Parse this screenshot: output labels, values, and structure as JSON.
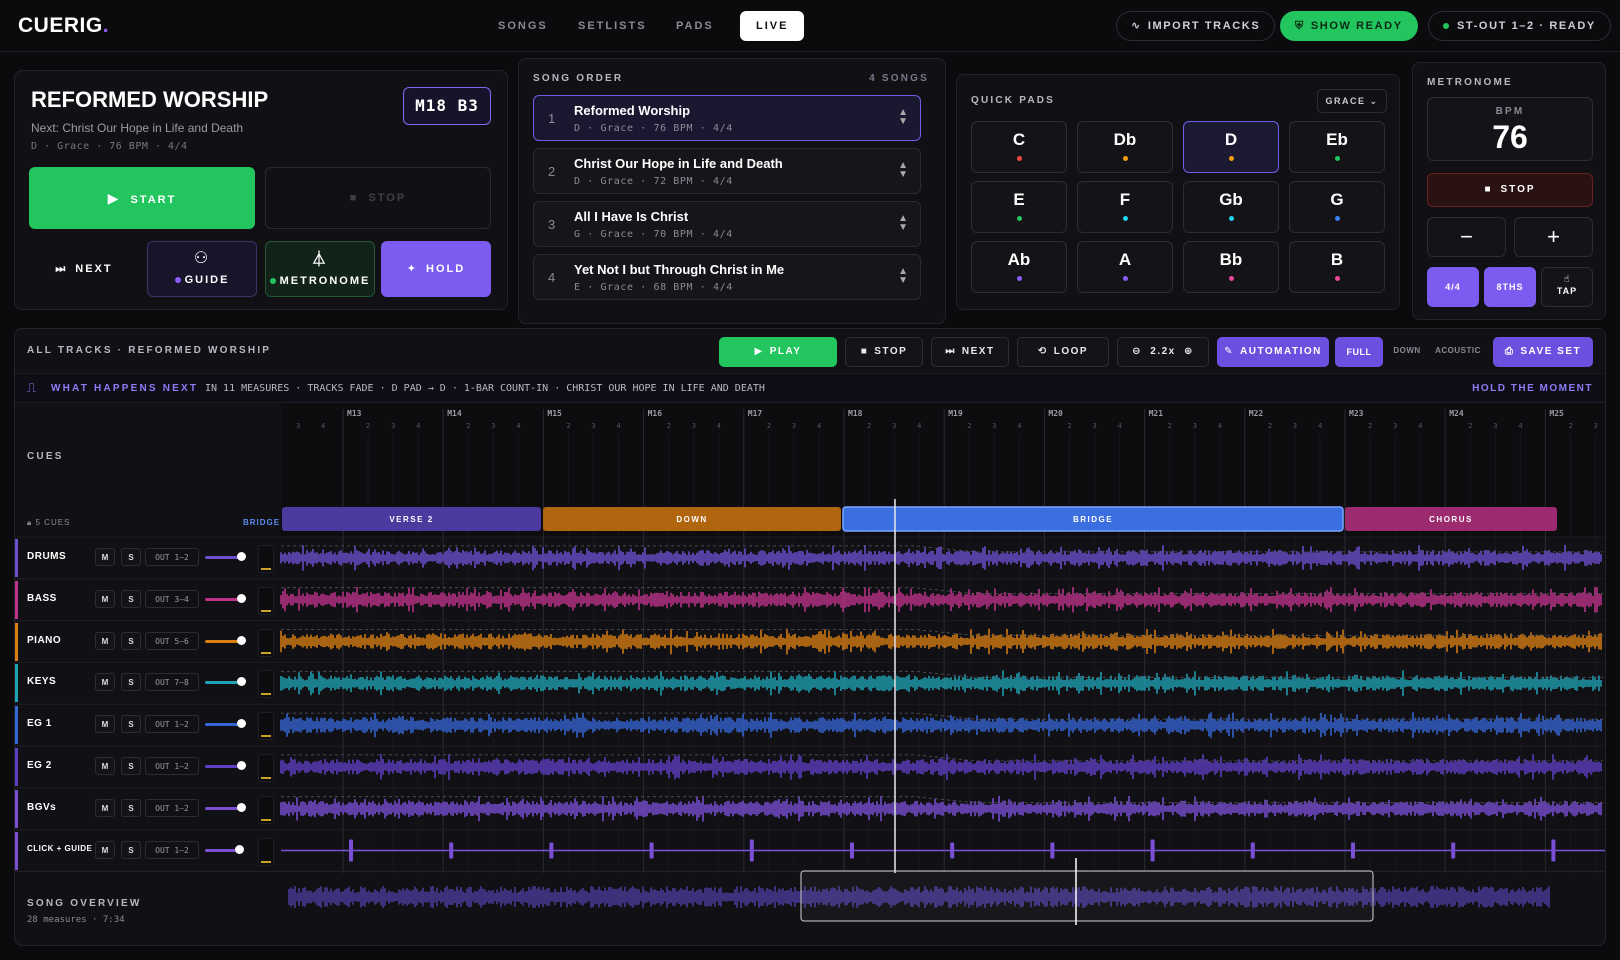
{
  "app": {
    "logo": "CUERIG",
    "logo_dot": "."
  },
  "nav": {
    "tabs": [
      {
        "label": "SONGS"
      },
      {
        "label": "SETLISTS"
      },
      {
        "label": "PADS"
      },
      {
        "label": "LIVE"
      }
    ],
    "active": "LIVE"
  },
  "topright": {
    "import_label": "IMPORT TRACKS",
    "show_ready_label": "SHOW READY",
    "output_status": "ST-OUT 1–2 · READY"
  },
  "current": {
    "title": "REFORMED WORSHIP",
    "next_line": "Next: Christ Our Hope in Life and Death",
    "meta": "D · Grace · 76 BPM · 4/4",
    "position": "M18 B3",
    "start_label": "START",
    "stop_label": "STOP",
    "next_label": "NEXT",
    "guide_label": "GUIDE",
    "metronome_label": "METRONOME",
    "hold_label": "HOLD"
  },
  "song_order": {
    "label": "SONG ORDER",
    "count": "4 SONGS",
    "songs": [
      {
        "num": "1",
        "title": "Reformed Worship",
        "meta": "D · Grace · 76 BPM · 4/4"
      },
      {
        "num": "2",
        "title": "Christ Our Hope in Life and Death",
        "meta": "D · Grace · 72 BPM · 4/4"
      },
      {
        "num": "3",
        "title": "All I Have Is Christ",
        "meta": "G · Grace · 70 BPM · 4/4"
      },
      {
        "num": "4",
        "title": "Yet Not I but Through Christ in Me",
        "meta": "E · Grace · 68 BPM · 4/4"
      }
    ]
  },
  "quick_pads": {
    "label": "QUICK PADS",
    "set_label": "GRACE",
    "active": "D",
    "pads": [
      {
        "key": "C",
        "color": "#ef4444"
      },
      {
        "key": "Db",
        "color": "#f59e0b"
      },
      {
        "key": "D",
        "color": "#f59e0b"
      },
      {
        "key": "Eb",
        "color": "#22c55e"
      },
      {
        "key": "E",
        "color": "#22c55e"
      },
      {
        "key": "F",
        "color": "#22d3ee"
      },
      {
        "key": "Gb",
        "color": "#22d3ee"
      },
      {
        "key": "G",
        "color": "#3b82f6"
      },
      {
        "key": "Ab",
        "color": "#8b5cf6"
      },
      {
        "key": "A",
        "color": "#8b5cf6"
      },
      {
        "key": "Bb",
        "color": "#ec4899"
      },
      {
        "key": "B",
        "color": "#ec4899"
      }
    ]
  },
  "metronome": {
    "label": "METRONOME",
    "bpm_label": "BPM",
    "bpm": "76",
    "stop_label": "STOP",
    "minus": "−",
    "plus": "+",
    "sig_label": "4/4",
    "sub_label": "8THS",
    "tap_label": "TAP"
  },
  "transport": {
    "title": "ALL TRACKS · REFORMED WORSHIP",
    "play": "PLAY",
    "stop": "STOP",
    "next": "NEXT",
    "loop": "LOOP",
    "zoom": "2.2x",
    "automation": "AUTOMATION",
    "arr_full": "FULL",
    "arr_down": "DOWN",
    "arr_acoustic": "ACOUSTIC",
    "save_set": "SAVE SET"
  },
  "next_bar": {
    "label": "WHAT HAPPENS NEXT",
    "text": "IN 11 MEASURES · TRACKS FADE · D PAD → D · 1-BAR COUNT-IN · CHRIST OUR HOPE IN LIFE AND DEATH",
    "hold": "HOLD THE MOMENT"
  },
  "ruler": {
    "measures": [
      "M13",
      "M14",
      "M15",
      "M16",
      "M17",
      "M18",
      "M19",
      "M20",
      "M21",
      "M22",
      "M23",
      "M24",
      "M25"
    ],
    "beats": [
      "2",
      "3",
      "4"
    ]
  },
  "cues": {
    "label": "CUES",
    "count": "5 CUES",
    "current": "BRIDGE",
    "sections": [
      {
        "name": "VERSE 2",
        "color": "#4c3a9e"
      },
      {
        "name": "DOWN",
        "color": "#b2650f"
      },
      {
        "name": "BRIDGE",
        "color": "#3b6fe0"
      },
      {
        "name": "CHORUS",
        "color": "#9b2a6e"
      }
    ]
  },
  "tracks": [
    {
      "name": "DRUMS",
      "out": "OUT 1–2",
      "color": "#6d4fd0",
      "level": 0.85
    },
    {
      "name": "BASS",
      "out": "OUT 3–4",
      "color": "#c0338a",
      "level": 0.85
    },
    {
      "name": "PIANO",
      "out": "OUT 5–6",
      "color": "#d97f12",
      "level": 0.85
    },
    {
      "name": "KEYS",
      "out": "OUT 7–8",
      "color": "#1fa3b5",
      "level": 0.85
    },
    {
      "name": "EG 1",
      "out": "OUT 1–2",
      "color": "#3566d6",
      "level": 0.85
    },
    {
      "name": "EG 2",
      "out": "OUT 1–2",
      "color": "#5e3fc4",
      "level": 0.85
    },
    {
      "name": "BGVs",
      "out": "OUT 1–2",
      "color": "#7a4fd6",
      "level": 0.85
    },
    {
      "name": "CLICK + GUIDE",
      "out": "OUT 1–2",
      "color": "#7a4fd6",
      "level": 0.8
    }
  ],
  "track_buttons": {
    "mute": "M",
    "solo": "S"
  },
  "overview": {
    "label": "SONG OVERVIEW",
    "meta": "28 measures · 7:34"
  }
}
